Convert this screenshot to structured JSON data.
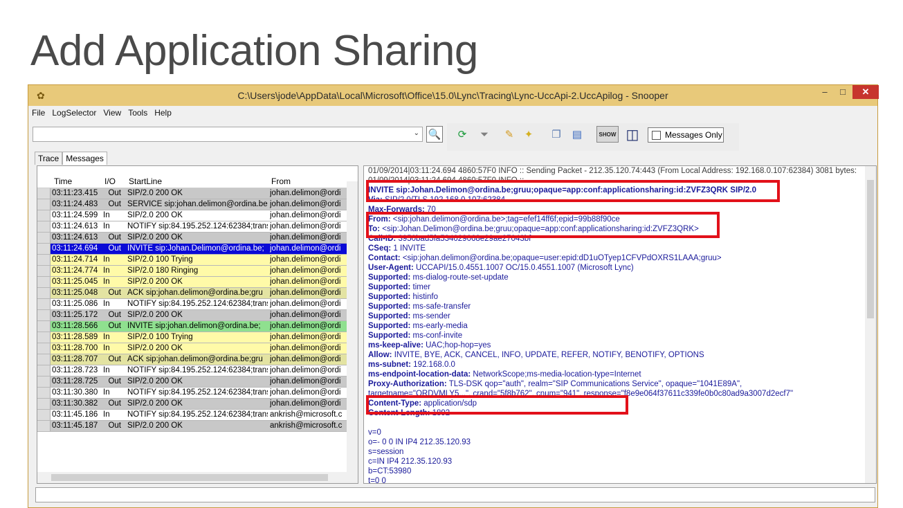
{
  "slide_title": "Add Application Sharing",
  "window": {
    "title": "C:\\Users\\jode\\AppData\\Local\\Microsoft\\Office\\15.0\\Lync\\Tracing\\Lync-UccApi-2.UccApilog - Snooper",
    "min": "–",
    "max": "□",
    "close": "✕"
  },
  "menu": [
    "File",
    "LogSelector",
    "View",
    "Tools",
    "Help"
  ],
  "toolbar": {
    "search_value": "",
    "show_label": "SHOW",
    "messages_only": "Messages Only"
  },
  "tabs": [
    {
      "label": "Trace"
    },
    {
      "label": "Messages"
    }
  ],
  "grid": {
    "headers": {
      "time": "Time",
      "io": "I/O",
      "start": "StartLine",
      "from": "From"
    },
    "rows": [
      {
        "time": "03:11:23.415",
        "io": "Out",
        "start": "SIP/2.0 200 OK",
        "from": "johan.delimon@ordi",
        "color": "#c8c8c8"
      },
      {
        "time": "03:11:24.483",
        "io": "Out",
        "start": "SERVICE sip:johan.delimon@ordina.be",
        "from": "johan.delimon@ordi",
        "color": "#c8c8c8"
      },
      {
        "time": "03:11:24.599",
        "io": "In",
        "start": "SIP/2.0 200 OK",
        "from": "johan.delimon@ordi",
        "color": "#ffffff"
      },
      {
        "time": "03:11:24.613",
        "io": "In",
        "start": "NOTIFY sip:84.195.252.124:62384;trans",
        "from": "johan.delimon@ordi",
        "color": "#ffffff"
      },
      {
        "time": "03:11:24.613",
        "io": "Out",
        "start": "SIP/2.0 200 OK",
        "from": "johan.delimon@ordi",
        "color": "#c8c8c8"
      },
      {
        "time": "03:11:24.694",
        "io": "Out",
        "start": "INVITE sip:Johan.Delimon@ordina.be;",
        "from": "johan.delimon@ordi",
        "color": "#0a0ad6",
        "selected": true
      },
      {
        "time": "03:11:24.714",
        "io": "In",
        "start": "SIP/2.0 100 Trying",
        "from": "johan.delimon@ordi",
        "color": "#fffaa8"
      },
      {
        "time": "03:11:24.774",
        "io": "In",
        "start": "SIP/2.0 180 Ringing",
        "from": "johan.delimon@ordi",
        "color": "#fffaa8"
      },
      {
        "time": "03:11:25.045",
        "io": "In",
        "start": "SIP/2.0 200 OK",
        "from": "johan.delimon@ordi",
        "color": "#fffaa8"
      },
      {
        "time": "03:11:25.048",
        "io": "Out",
        "start": "ACK sip:johan.delimon@ordina.be;gru",
        "from": "johan.delimon@ordi",
        "color": "#e3e3a2"
      },
      {
        "time": "03:11:25.086",
        "io": "In",
        "start": "NOTIFY sip:84.195.252.124:62384;trans",
        "from": "johan.delimon@ordi",
        "color": "#ffffff"
      },
      {
        "time": "03:11:25.172",
        "io": "Out",
        "start": "SIP/2.0 200 OK",
        "from": "johan.delimon@ordi",
        "color": "#c8c8c8"
      },
      {
        "time": "03:11:28.566",
        "io": "Out",
        "start": "INVITE sip:johan.delimon@ordina.be;",
        "from": "johan.delimon@ordi",
        "color": "#8fe08f"
      },
      {
        "time": "03:11:28.589",
        "io": "In",
        "start": "SIP/2.0 100 Trying",
        "from": "johan.delimon@ordi",
        "color": "#fffaa8"
      },
      {
        "time": "03:11:28.700",
        "io": "In",
        "start": "SIP/2.0 200 OK",
        "from": "johan.delimon@ordi",
        "color": "#fffaa8"
      },
      {
        "time": "03:11:28.707",
        "io": "Out",
        "start": "ACK sip:johan.delimon@ordina.be;gru",
        "from": "johan.delimon@ordi",
        "color": "#e3e3a2"
      },
      {
        "time": "03:11:28.723",
        "io": "In",
        "start": "NOTIFY sip:84.195.252.124:62384;trans",
        "from": "johan.delimon@ordi",
        "color": "#ffffff"
      },
      {
        "time": "03:11:28.725",
        "io": "Out",
        "start": "SIP/2.0 200 OK",
        "from": "johan.delimon@ordi",
        "color": "#c8c8c8"
      },
      {
        "time": "03:11:30.380",
        "io": "In",
        "start": "NOTIFY sip:84.195.252.124:62384;trans",
        "from": "johan.delimon@ordi",
        "color": "#ffffff"
      },
      {
        "time": "03:11:30.382",
        "io": "Out",
        "start": "SIP/2.0 200 OK",
        "from": "johan.delimon@ordi",
        "color": "#c8c8c8"
      },
      {
        "time": "03:11:45.186",
        "io": "In",
        "start": "NOTIFY sip:84.195.252.124:62384;trans",
        "from": "ankrish@microsoft.c",
        "color": "#ffffff"
      },
      {
        "time": "03:11:45.187",
        "io": "Out",
        "start": "SIP/2.0 200 OK",
        "from": "ankrish@microsoft.c",
        "color": "#c8c8c8"
      }
    ]
  },
  "log": [
    {
      "kind": "hdr",
      "text": "01/09/2014|03:11:24.694 4860:57F0 INFO  :: Sending Packet - 212.35.120.74:443 (From Local Address: 192.168.0.107:62384) 3081 bytes:"
    },
    {
      "kind": "hdr",
      "text": "01/09/2014|03:11:24.694 4860:57F0 INFO  ::"
    },
    {
      "kind": "b",
      "key": "",
      "text": "INVITE sip:Johan.Delimon@ordina.be;gruu;opaque=app:conf:applicationsharing:id:ZVFZ3QRK SIP/2.0"
    },
    {
      "kind": "kv",
      "key": "Via:",
      "text": " SIP/2.0/TLS 192.168.0.107:62384"
    },
    {
      "kind": "kv",
      "key": "Max-Forwards:",
      "text": " 70"
    },
    {
      "kind": "kv",
      "key": "From:",
      "text": " <sip:johan.delimon@ordina.be>;tag=efef14ff6f;epid=99b88f90ce"
    },
    {
      "kind": "kv",
      "key": "To:",
      "text": " <sip:Johan.Delimon@ordina.be;gruu;opaque=app:conf:applicationsharing:id:ZVFZ3QRK>"
    },
    {
      "kind": "kv",
      "key": "Call-ID:",
      "text": " 3950bad5fa534029068e29ae27043bf"
    },
    {
      "kind": "kv",
      "key": "CSeq:",
      "text": " 1 INVITE"
    },
    {
      "kind": "kv",
      "key": "Contact:",
      "text": " <sip:johan.delimon@ordina.be;opaque=user:epid:dD1uOTyep1CFVPdOXRS1LAAA;gruu>"
    },
    {
      "kind": "kv",
      "key": "User-Agent:",
      "text": " UCCAPI/15.0.4551.1007 OC/15.0.4551.1007 (Microsoft Lync)"
    },
    {
      "kind": "kv",
      "key": "Supported:",
      "text": " ms-dialog-route-set-update"
    },
    {
      "kind": "kv",
      "key": "Supported:",
      "text": " timer"
    },
    {
      "kind": "kv",
      "key": "Supported:",
      "text": " histinfo"
    },
    {
      "kind": "kv",
      "key": "Supported:",
      "text": " ms-safe-transfer"
    },
    {
      "kind": "kv",
      "key": "Supported:",
      "text": " ms-sender"
    },
    {
      "kind": "kv",
      "key": "Supported:",
      "text": " ms-early-media"
    },
    {
      "kind": "kv",
      "key": "Supported:",
      "text": " ms-conf-invite"
    },
    {
      "kind": "kv",
      "key": "ms-keep-alive:",
      "text": " UAC;hop-hop=yes"
    },
    {
      "kind": "kv",
      "key": "Allow:",
      "text": " INVITE, BYE, ACK, CANCEL, INFO, UPDATE, REFER, NOTIFY, BENOTIFY, OPTIONS"
    },
    {
      "kind": "kv",
      "key": "ms-subnet:",
      "text": " 192.168.0.0"
    },
    {
      "kind": "kv",
      "key": "ms-endpoint-location-data:",
      "text": " NetworkScope;ms-media-location-type=Internet"
    },
    {
      "kind": "kv",
      "key": "Proxy-Authorization:",
      "text": " TLS-DSK qop=\"auth\", realm=\"SIP Communications Service\", opaque=\"1041E89A\","
    },
    {
      "kind": "plain",
      "text": "  targetname=\"ORDVMLY5...\", crand=\"5f8b762\", cnum=\"941\", response=\"f8e9e064f37611c339fe0b0c80ad9a3007d2ecf7\""
    },
    {
      "kind": "kv",
      "key": "Content-Type:",
      "text": " application/sdp"
    },
    {
      "kind": "kv",
      "key": "Content-Length:",
      "text": " 1892"
    },
    {
      "kind": "plain",
      "text": ""
    },
    {
      "kind": "plain",
      "text": "v=0"
    },
    {
      "kind": "plain",
      "text": "o=- 0 0 IN IP4 212.35.120.93"
    },
    {
      "kind": "plain",
      "text": "s=session"
    },
    {
      "kind": "plain",
      "text": "c=IN IP4 212.35.120.93"
    },
    {
      "kind": "plain",
      "text": "b=CT:53980"
    },
    {
      "kind": "plain",
      "text": "t=0 0"
    }
  ],
  "colors": {
    "highlight": "#e2111a",
    "selected_row": "#0a0ad6",
    "log_text": "#1a1a9a"
  }
}
